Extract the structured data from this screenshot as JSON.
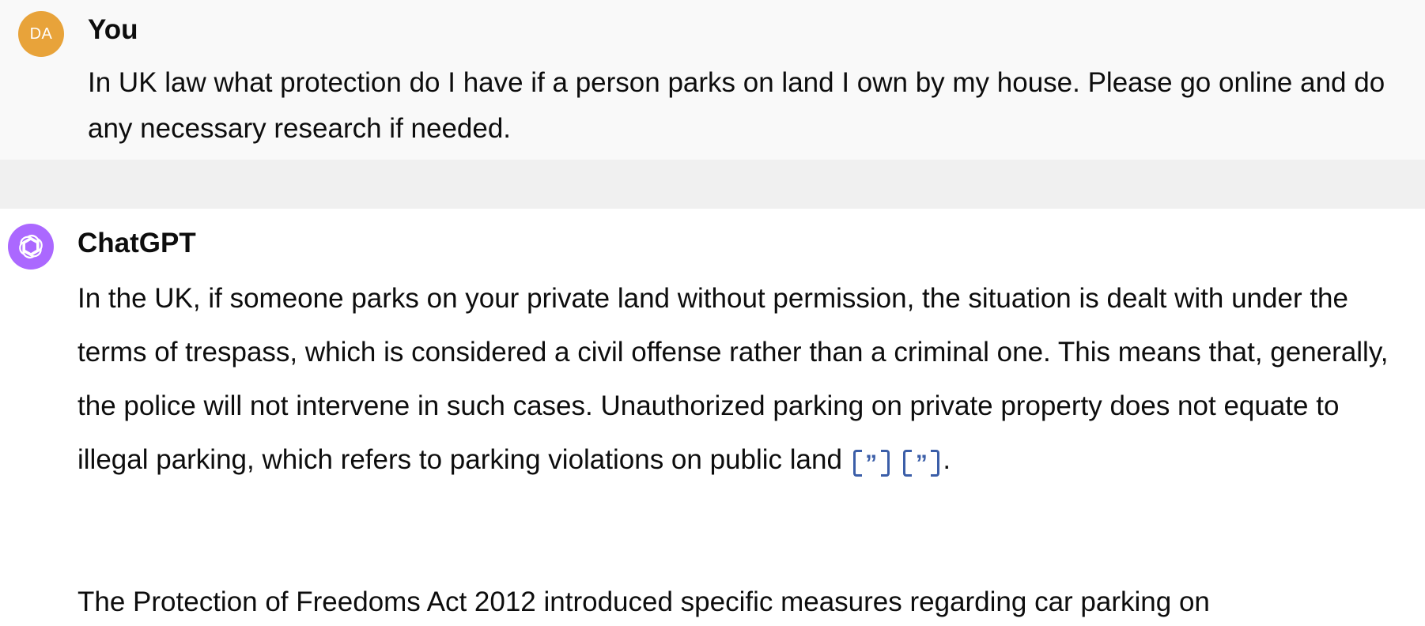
{
  "user": {
    "avatar_initials": "DA",
    "avatar_color": "#e8a33a",
    "author": "You",
    "message": "In UK law what protection do I have if a person parks on land I own by my house. Please go online and do any necessary research if needed."
  },
  "assistant": {
    "avatar_icon": "openai-logo-icon",
    "avatar_color": "#ab68ff",
    "author": "ChatGPT",
    "paragraph1": "In the UK, if someone parks on your private land without permission, the situation is dealt with under the terms of trespass, which is considered a civil offense rather than a criminal one. This means that, generally, the police will not intervene in such cases. Unauthorized parking on private property does not equate to illegal parking, which refers to parking violations on public land",
    "citation_glyph": "”",
    "paragraph1_end": ".",
    "paragraph2": "The Protection of Freedoms Act 2012 introduced specific measures regarding car parking on"
  },
  "colors": {
    "user_background": "#f9f9f9",
    "separator_background": "#f0f0f0",
    "citation": "#3b5ea8"
  }
}
